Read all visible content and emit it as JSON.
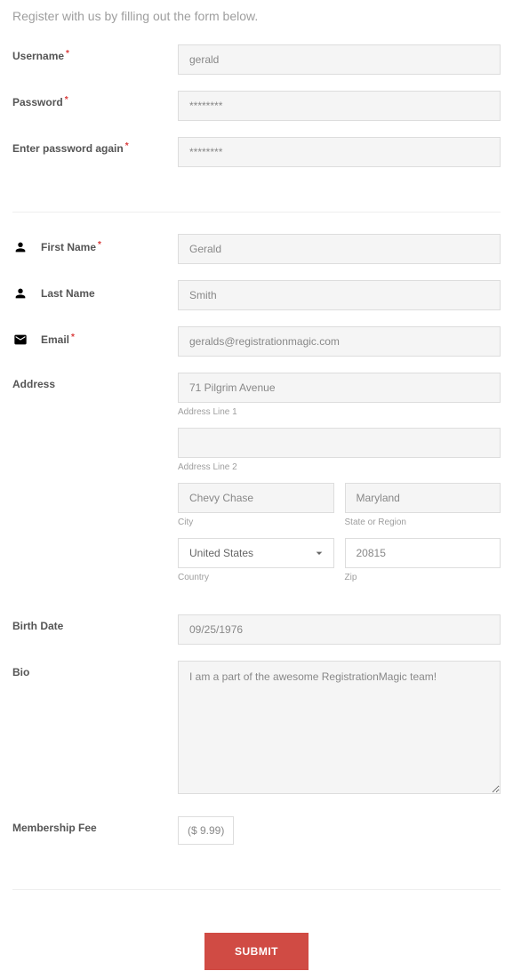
{
  "intro": "Register with us by filling out the form below.",
  "labels": {
    "username": "Username",
    "password": "Password",
    "password_again": "Enter password again",
    "first_name": "First Name",
    "last_name": "Last Name",
    "email": "Email",
    "address": "Address",
    "birth_date": "Birth Date",
    "bio": "Bio",
    "fee": "Membership Fee"
  },
  "sublabels": {
    "addr1": "Address Line 1",
    "addr2": "Address Line 2",
    "city": "City",
    "state": "State or Region",
    "country": "Country",
    "zip": "Zip"
  },
  "values": {
    "username": "gerald",
    "password": "********",
    "password_again": "********",
    "first_name": "Gerald",
    "last_name": "Smith",
    "email": "geralds@registrationmagic.com",
    "addr1": "71 Pilgrim Avenue",
    "addr2": "",
    "city": "Chevy Chase",
    "state": "Maryland",
    "country": "United States",
    "zip": "20815",
    "birth_date": "09/25/1976",
    "bio": "I am a part of the awesome RegistrationMagic team!",
    "fee": "($ 9.99)"
  },
  "required_mark": "*",
  "submit": "SUBMIT"
}
